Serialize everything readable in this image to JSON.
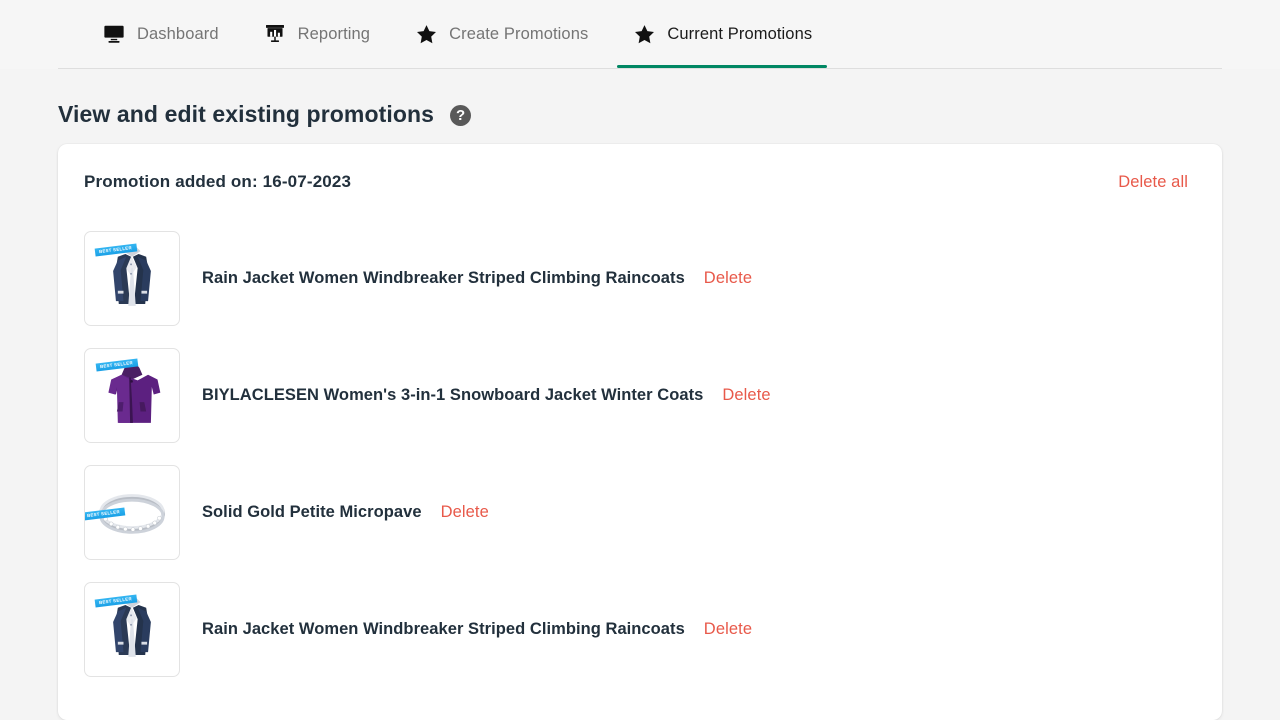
{
  "nav": {
    "tabs": [
      {
        "label": "Dashboard",
        "icon": "monitor-icon",
        "active": false
      },
      {
        "label": "Reporting",
        "icon": "bar-chart-icon",
        "active": false
      },
      {
        "label": "Create Promotions",
        "icon": "star-icon",
        "active": false
      },
      {
        "label": "Current Promotions",
        "icon": "star-icon",
        "active": true
      }
    ],
    "active_underline_color": "#008763",
    "inactive_label_color": "#757575",
    "active_label_color": "#1b1b1b"
  },
  "page": {
    "title": "View and edit existing promotions",
    "help_icon_glyph": "?"
  },
  "card": {
    "added_on_label": "Promotion added on: 16-07-2023",
    "delete_all_label": "Delete all",
    "delete_link_color": "#e8594a",
    "rows": [
      {
        "title": "Rain Jacket Women Windbreaker Striped Climbing Raincoats",
        "delete_label": "Delete",
        "image": "navy-rain-jacket",
        "badge": "BEST SELLER"
      },
      {
        "title": "BIYLACLESEN Women's 3-in-1 Snowboard Jacket Winter Coats",
        "delete_label": "Delete",
        "image": "purple-snowboard-jacket",
        "badge": "BEST SELLER"
      },
      {
        "title": "Solid Gold Petite Micropave",
        "delete_label": "Delete",
        "image": "silver-diamond-bangle",
        "badge": "BEST SELLER"
      },
      {
        "title": "Rain Jacket Women Windbreaker Striped Climbing Raincoats",
        "delete_label": "Delete",
        "image": "navy-rain-jacket",
        "badge": "BEST SELLER"
      }
    ]
  }
}
